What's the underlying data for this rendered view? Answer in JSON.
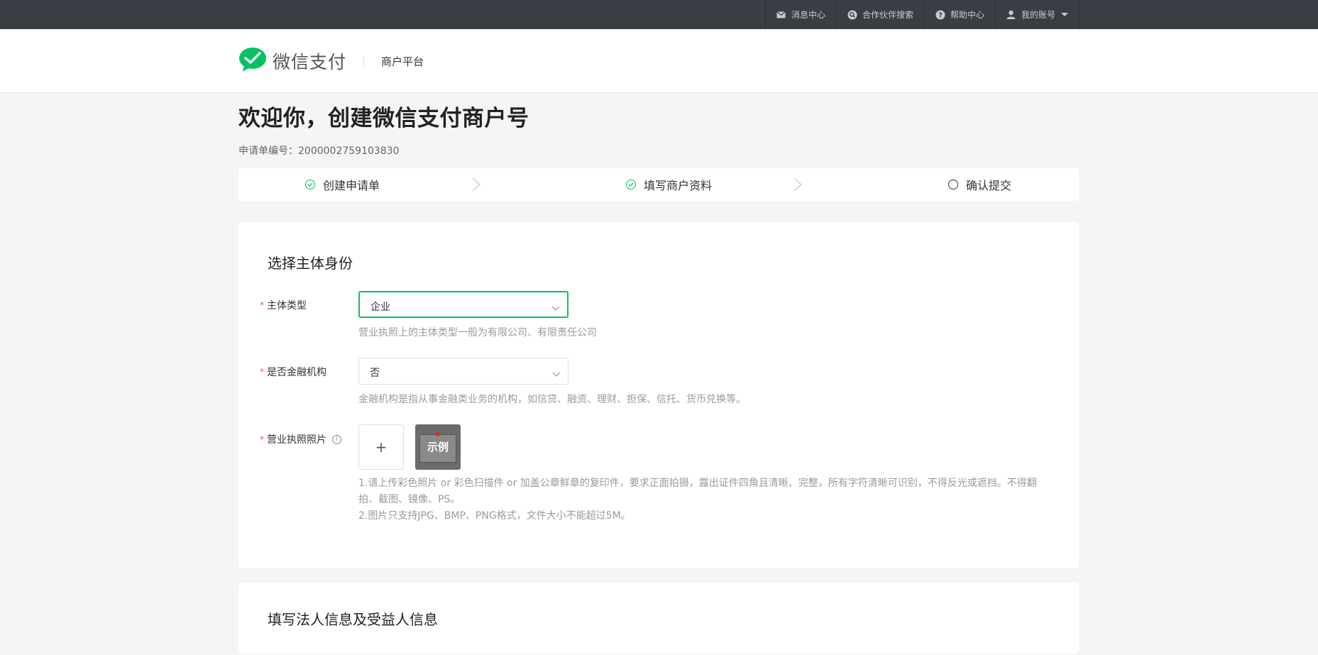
{
  "topnav": {
    "items": [
      {
        "label": "消息中心",
        "icon": "mail-icon"
      },
      {
        "label": "合作伙伴搜索",
        "icon": "search-icon"
      },
      {
        "label": "帮助中心",
        "icon": "help-icon"
      },
      {
        "label": "我的账号",
        "icon": "user-icon"
      }
    ]
  },
  "header": {
    "logo_text": "微信支付",
    "subtitle": "商户平台"
  },
  "page": {
    "title": "欢迎你，创建微信支付商户号",
    "order_label": "申请单编号：",
    "order_number": "2000002759103830"
  },
  "steps": [
    {
      "label": "创建申请单",
      "status": "done"
    },
    {
      "label": "填写商户资料",
      "status": "done"
    },
    {
      "label": "确认提交",
      "status": "todo"
    }
  ],
  "section1": {
    "title": "选择主体身份",
    "entity_type": {
      "label": "主体类型",
      "value": "企业",
      "hint": "营业执照上的主体类型一般为有限公司、有限责任公司"
    },
    "financial": {
      "label": "是否金融机构",
      "value": "否",
      "hint": "金融机构是指从事金融类业务的机构，如信贷、融资、理财、担保、信托、货币兑换等。"
    },
    "license": {
      "label": "营业执照照片",
      "upload_symbol": "+",
      "sample_label": "示例",
      "hint1": "1.请上传彩色照片 or 彩色扫描件 or 加盖公章鲜章的复印件，要求正面拍摄，露出证件四角且清晰、完整，所有字符清晰可识别，不得反光或遮挡。不得翻",
      "hint1b": "拍、截图、镜像、PS。",
      "hint2": "2.图片只支持JPG、BMP、PNG格式，文件大小不能超过5M。"
    }
  },
  "section2": {
    "title": "填写法人信息及受益人信息"
  },
  "colors": {
    "accent": "#07c160",
    "required": "#fa5151",
    "topbar": "#3b3d44"
  }
}
